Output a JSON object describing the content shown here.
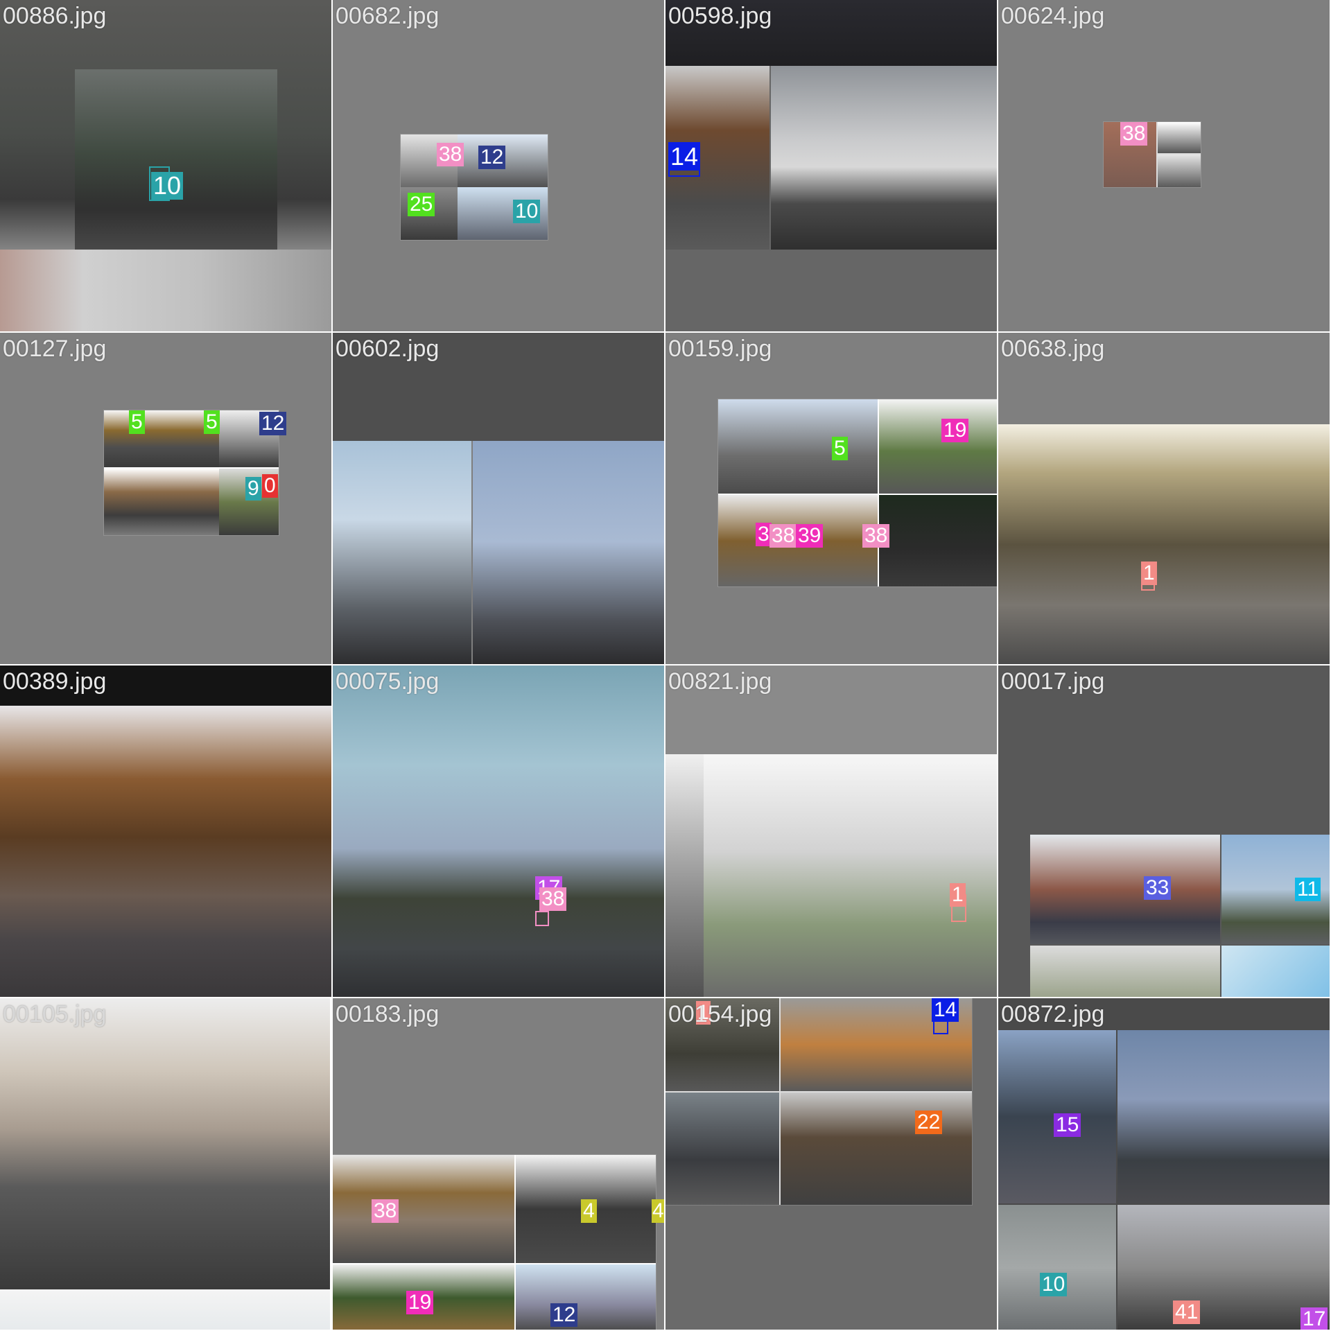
{
  "grid_title": "",
  "tiles": [
    {
      "filename": "00886.jpg",
      "labels": [
        "10"
      ]
    },
    {
      "filename": "00682.jpg",
      "labels": [
        "38",
        "12",
        "25",
        "10"
      ]
    },
    {
      "filename": "00598.jpg",
      "labels": [
        "14"
      ]
    },
    {
      "filename": "00624.jpg",
      "labels": [
        "38"
      ]
    },
    {
      "filename": "00127.jpg",
      "labels": [
        "5",
        "5",
        "12",
        "9",
        "0"
      ]
    },
    {
      "filename": "00602.jpg",
      "labels": []
    },
    {
      "filename": "00159.jpg",
      "labels": [
        "5",
        "19",
        "3",
        "38",
        "39",
        "38"
      ]
    },
    {
      "filename": "00638.jpg",
      "labels": [
        "1"
      ]
    },
    {
      "filename": "00389.jpg",
      "labels": []
    },
    {
      "filename": "00075.jpg",
      "labels": [
        "17",
        "38"
      ]
    },
    {
      "filename": "00821.jpg",
      "labels": [
        "1"
      ]
    },
    {
      "filename": "00017.jpg",
      "labels": [
        "33",
        "11"
      ]
    },
    {
      "filename": "00105.jpg",
      "labels": []
    },
    {
      "filename": "00183.jpg",
      "labels": [
        "38",
        "4",
        "4",
        "19",
        "12"
      ]
    },
    {
      "filename": "00154.jpg",
      "labels": [
        "1",
        "14",
        "22"
      ]
    },
    {
      "filename": "00872.jpg",
      "labels": [
        "15",
        "10",
        "41",
        "17"
      ]
    }
  ],
  "colors": {
    "gray_fill": "#7f7f7f",
    "pink": "#f28fc4",
    "navy": "#2e3d8c",
    "green": "#52e01f",
    "teal": "#2aa3a8",
    "blue": "#0a1ee6",
    "magenta": "#f02db8",
    "salmon": "#f28b86",
    "violet": "#8a2be2",
    "purple_light": "#c24fe8",
    "periwinkle": "#5a5fe0",
    "cyan": "#0fb9e8",
    "orange": "#f26a1b",
    "olive": "#c9c92c",
    "red": "#e63232",
    "yellow": "#d9d92e"
  }
}
